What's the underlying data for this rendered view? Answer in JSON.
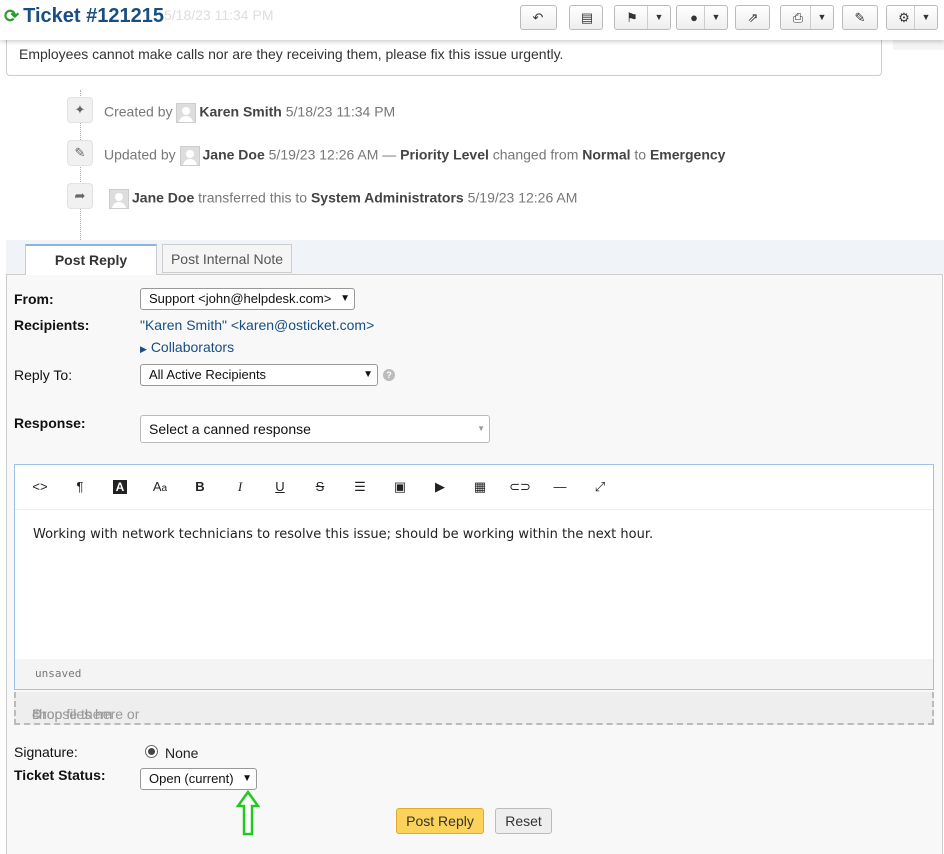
{
  "header": {
    "refresh_icon": "refresh-icon",
    "title": "Ticket #121215",
    "ghost_text": "5/18/23 11:34 PM"
  },
  "description": "Employees cannot make calls nor are they receiving them, please fix this issue urgently.",
  "events": [
    {
      "icon": "magic-wand-icon",
      "prefix": "Created by",
      "user": "Karen Smith",
      "date": "5/18/23 11:34 PM"
    },
    {
      "icon": "pencil-icon",
      "prefix": "Updated by",
      "user": "Jane Doe",
      "date": "5/19/23 12:26 AM —",
      "field": "Priority Level",
      "mid": "changed from",
      "from": "Normal",
      "to_word": "to",
      "to": "Emergency"
    },
    {
      "icon": "share-icon",
      "user": "Jane Doe",
      "mid": "transferred this to",
      "dept": "System Administrators",
      "date": "5/19/23 12:26 AM"
    }
  ],
  "tabs": {
    "post_reply": "Post Reply",
    "internal_note": "Post Internal Note"
  },
  "form": {
    "from_label": "From:",
    "from_value": "Support <john@helpdesk.com>",
    "recipients_label": "Recipients:",
    "recipients_value": "\"Karen Smith\" <karen@osticket.com>",
    "collaborators": "Collaborators",
    "reply_to_label": "Reply To:",
    "reply_to_value": "All Active Recipients",
    "response_label": "Response:",
    "response_placeholder": "Select a canned response",
    "editor_text": "Working with network technicians to resolve this issue; should be working within the next hour.",
    "editor_status": "unsaved",
    "drop_text": "Drop files here or",
    "drop_link": "choose them",
    "signature_label": "Signature:",
    "signature_value": "None",
    "status_label": "Ticket Status:",
    "status_value": "Open (current)"
  },
  "buttons": {
    "post_reply": "Post Reply",
    "reset": "Reset"
  },
  "colors": {
    "brand": "#184e81",
    "post_button": "#fcd35a",
    "annotation_arrow": "#22c922"
  }
}
